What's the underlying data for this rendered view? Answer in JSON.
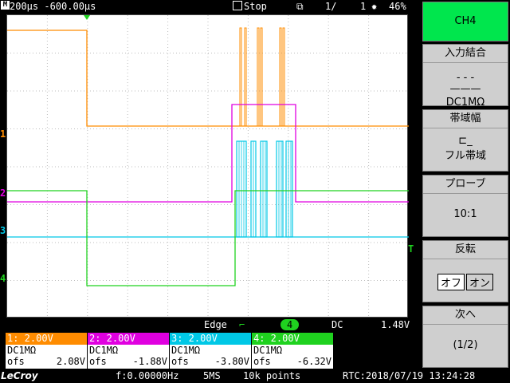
{
  "topbar": {
    "timebase_icon": "M",
    "timebase": "200µs -600.00µs",
    "run_state": "Stop",
    "page": "1/",
    "page_total": "1",
    "memory": "46%"
  },
  "plot": {
    "channel_colors": {
      "ch1": "#ff8c00",
      "ch2": "#e000e0",
      "ch3": "#00c8e6",
      "ch4": "#1fd21f"
    },
    "marker_labels": {
      "ch1": "1",
      "ch2": "2",
      "ch3": "3",
      "ch4": "4",
      "trigger_level": "T"
    }
  },
  "trigger": {
    "type": "Edge",
    "source": "4",
    "coupling": "DC",
    "level": "1.48V"
  },
  "channels": [
    {
      "label": "1: 2.00V",
      "coupling": "DC1MΩ",
      "ofs_label": "ofs",
      "ofs_value": "2.08V",
      "color": "#ff8c00"
    },
    {
      "label": "2: 2.00V",
      "coupling": "DC1MΩ",
      "ofs_label": "ofs",
      "ofs_value": "-1.88V",
      "color": "#e000e0"
    },
    {
      "label": "3: 2.00V",
      "coupling": "DC1MΩ",
      "ofs_label": "ofs",
      "ofs_value": "-3.80V",
      "color": "#00c8e6"
    },
    {
      "label": "4: 2.00V",
      "coupling": "DC1MΩ",
      "ofs_label": "ofs",
      "ofs_value": "-6.32V",
      "color": "#1fd21f"
    }
  ],
  "bottombar": {
    "brand": "LeCroy",
    "frequency": "f:0.00000Hz",
    "sample_rate": "5MS",
    "points": "10k points",
    "rtc": "RTC:2018/07/19 13:24:28"
  },
  "menu": {
    "header": "CH4",
    "header_color": "#00e64d",
    "input_coupling": {
      "title": "入力結合",
      "value": "DC1MΩ"
    },
    "bandwidth": {
      "title": "帯域幅",
      "value": "フル帯域"
    },
    "probe": {
      "title": "プローブ",
      "value": "10:1"
    },
    "invert": {
      "title": "反転",
      "off": "オフ",
      "on": "オン"
    },
    "next": {
      "title": "次へ",
      "value": "(1/2)"
    }
  }
}
